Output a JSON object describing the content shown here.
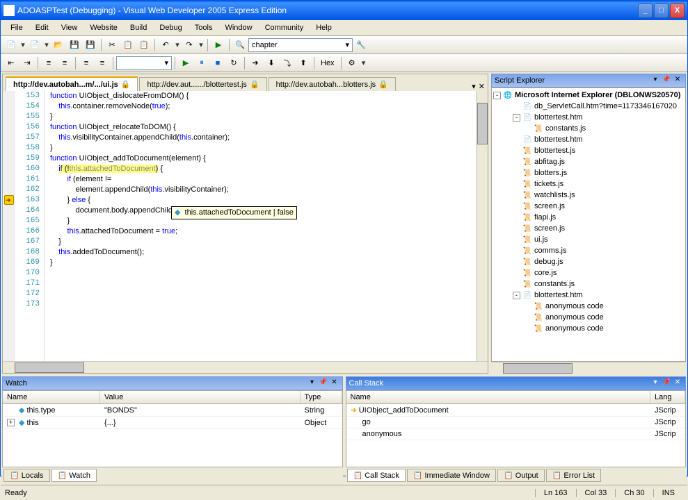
{
  "title": "ADOASPTest (Debugging) - Visual Web Developer 2005 Express Edition",
  "menu": [
    "File",
    "Edit",
    "View",
    "Website",
    "Build",
    "Debug",
    "Tools",
    "Window",
    "Community",
    "Help"
  ],
  "combo1": "chapter",
  "hex": "Hex",
  "tabs": [
    {
      "label": "http://dev.autobah...m/.../ui.js",
      "active": true
    },
    {
      "label": "http://dev.aut....../blottertest.js",
      "active": false
    },
    {
      "label": "http://dev.autobah...blotters.js",
      "active": false
    }
  ],
  "code": {
    "start": 153,
    "lines": [
      "",
      "function UIObject_dislocateFromDOM() {",
      "    this.container.removeNode(true);",
      "}",
      "",
      "function UIObject_relocateToDOM() {",
      "    this.visibilityContainer.appendChild(this.container);",
      "}",
      "",
      "function UIObject_addToDocument(element) {",
      "    if (!this.attachedToDocument) {",
      "        if (element !=",
      "            element.appendChild(this.visibilityContainer);",
      "        } else {",
      "            document.body.appendChild(this.visibilityContainer);",
      "        }",
      "        this.attachedToDocument = true;",
      "    }",
      "    this.addedToDocument();",
      "}",
      ""
    ],
    "tooltip": "this.attachedToDocument | false",
    "breakpoint_line": 163
  },
  "script_explorer": {
    "title": "Script Explorer",
    "root": "Microsoft Internet Explorer (DBLONWS20570)",
    "items": [
      {
        "indent": 1,
        "label": "db_ServletCall.htm?time=1173346167020",
        "icon": "page"
      },
      {
        "indent": 1,
        "label": "blottertest.htm",
        "icon": "page",
        "expand": "-"
      },
      {
        "indent": 2,
        "label": "constants.js",
        "icon": "js"
      },
      {
        "indent": 1,
        "label": "blottertest.htm",
        "icon": "page"
      },
      {
        "indent": 1,
        "label": "blottertest.js",
        "icon": "js"
      },
      {
        "indent": 1,
        "label": "abfitag.js",
        "icon": "js"
      },
      {
        "indent": 1,
        "label": "blotters.js",
        "icon": "js"
      },
      {
        "indent": 1,
        "label": "tickets.js",
        "icon": "js"
      },
      {
        "indent": 1,
        "label": "watchlists.js",
        "icon": "js"
      },
      {
        "indent": 1,
        "label": "screen.js",
        "icon": "js"
      },
      {
        "indent": 1,
        "label": "fiapi.js",
        "icon": "js"
      },
      {
        "indent": 1,
        "label": "screen.js",
        "icon": "js"
      },
      {
        "indent": 1,
        "label": "ui.js",
        "icon": "js"
      },
      {
        "indent": 1,
        "label": "comms.js",
        "icon": "js"
      },
      {
        "indent": 1,
        "label": "debug.js",
        "icon": "js"
      },
      {
        "indent": 1,
        "label": "core.js",
        "icon": "js"
      },
      {
        "indent": 1,
        "label": "constants.js",
        "icon": "js"
      },
      {
        "indent": 1,
        "label": "blottertest.htm",
        "icon": "page",
        "expand": "-"
      },
      {
        "indent": 2,
        "label": "anonymous code",
        "icon": "js"
      },
      {
        "indent": 2,
        "label": "anonymous code",
        "icon": "js"
      },
      {
        "indent": 2,
        "label": "anonymous code",
        "icon": "js"
      }
    ]
  },
  "watch": {
    "title": "Watch",
    "cols": [
      "Name",
      "Value",
      "Type"
    ],
    "rows": [
      {
        "name": "this.type",
        "value": "\"BONDS\"",
        "type": "String",
        "icon": "◆"
      },
      {
        "name": "this",
        "value": "{...}",
        "type": "Object",
        "icon": "◆",
        "expand": "+"
      }
    ],
    "tabs": [
      "Locals",
      "Watch"
    ]
  },
  "callstack": {
    "title": "Call Stack",
    "cols": [
      "Name",
      "Lang"
    ],
    "rows": [
      {
        "name": "UIObject_addToDocument",
        "lang": "JScrip",
        "icon": "➜"
      },
      {
        "name": "go",
        "lang": "JScrip"
      },
      {
        "name": "anonymous",
        "lang": "JScrip"
      }
    ],
    "tabs": [
      "Call Stack",
      "Immediate Window",
      "Output",
      "Error List"
    ]
  },
  "status": {
    "ready": "Ready",
    "ln": "Ln 163",
    "col": "Col 33",
    "ch": "Ch 30",
    "ins": "INS"
  }
}
